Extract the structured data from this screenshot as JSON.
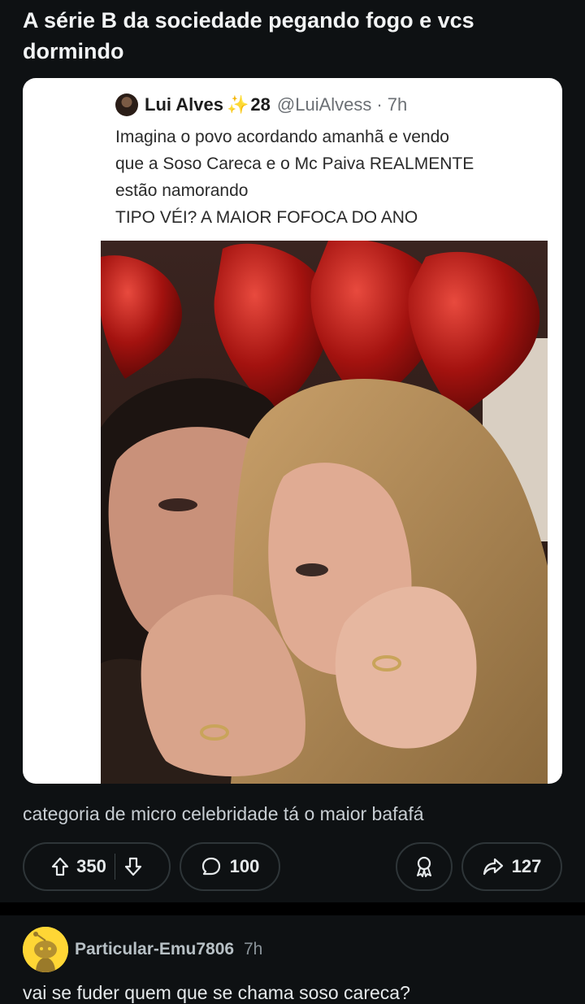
{
  "post": {
    "title": "A série B da sociedade pegando fogo e vcs dormindo",
    "caption": "categoria de micro celebridade tá o maior bafafá"
  },
  "tweet": {
    "name": "Lui Alves",
    "sparkle": "✨",
    "number": "28",
    "handle": "@LuiAlvess",
    "dot": "·",
    "time": "7h",
    "lines": [
      "Imagina o povo acordando amanhã e vendo",
      "que a Soso Careca e o Mc Paiva REALMENTE",
      "estão namorando",
      "TIPO VÉI? A MAIOR FOFOCA DO ANO"
    ]
  },
  "actions": {
    "upvotes": "350",
    "comments": "100",
    "shares": "127"
  },
  "comment": {
    "author": "Particular-Emu7806",
    "time": "7h",
    "body": "vai se fuder quem que se chama soso careca?"
  },
  "colors": {
    "background": "#0e1113",
    "avatar": "#ffd635",
    "pill_border": "#2e3538"
  }
}
